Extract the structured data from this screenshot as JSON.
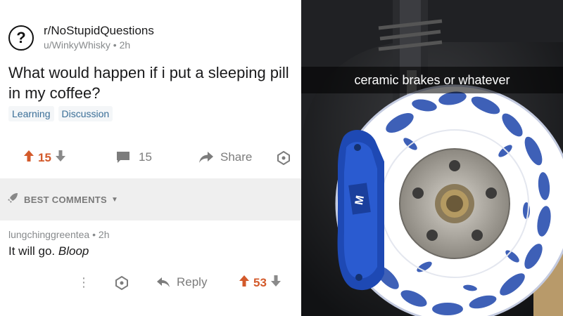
{
  "post": {
    "subreddit": "r/NoStupidQuestions",
    "author": "u/WinkyWhisky",
    "age": "2h",
    "title": "What would happen if i put a sleeping pill in my coffee?",
    "tags": [
      "Learning",
      "Discussion"
    ],
    "score": "15",
    "comments": "15",
    "share_label": "Share"
  },
  "best_comments_label": "BEST COMMENTS",
  "comment": {
    "author": "lungchinggreentea",
    "age": "2h",
    "text": "It will go.",
    "text_italic": "Bloop",
    "reply_label": "Reply",
    "score": "53"
  },
  "photo": {
    "caption": "ceramic brakes or whatever",
    "caliper_text": "M",
    "colors": {
      "caliper": "#1e49b4",
      "rotor_pattern": "#2a4fb0",
      "rotor_base": "#ffffff"
    }
  },
  "colors": {
    "upvote": "#d35a2b",
    "tag_text": "#3a6e97",
    "muted": "#878a8c"
  }
}
